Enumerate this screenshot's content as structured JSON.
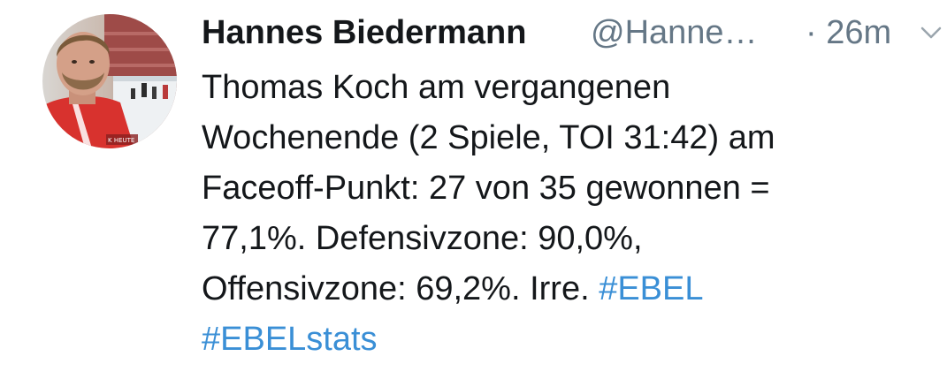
{
  "tweet": {
    "author": {
      "name": "Hannes Biedermann",
      "handle": "@Hanne…",
      "avatar": "profile-photo",
      "avatar_watermark": "K HEUTE"
    },
    "timestamp": "· 26m",
    "menu_icon": "chevron-down-icon",
    "text_lines": [
      "Thomas Koch am vergangenen",
      "Wochenende (2 Spiele, TOI 31:42) am",
      "Faceoff-Punkt: 27 von 35 gewonnen =",
      "77,1%. Defensivzone: 90,0%,",
      "Offensivzone: 69,2%. Irre. "
    ],
    "hashtags": [
      "#EBEL",
      "#EBELstats"
    ]
  },
  "colors": {
    "name": "#14171a",
    "secondary": "#657786",
    "link": "#3a8fd6",
    "background": "#ffffff"
  }
}
